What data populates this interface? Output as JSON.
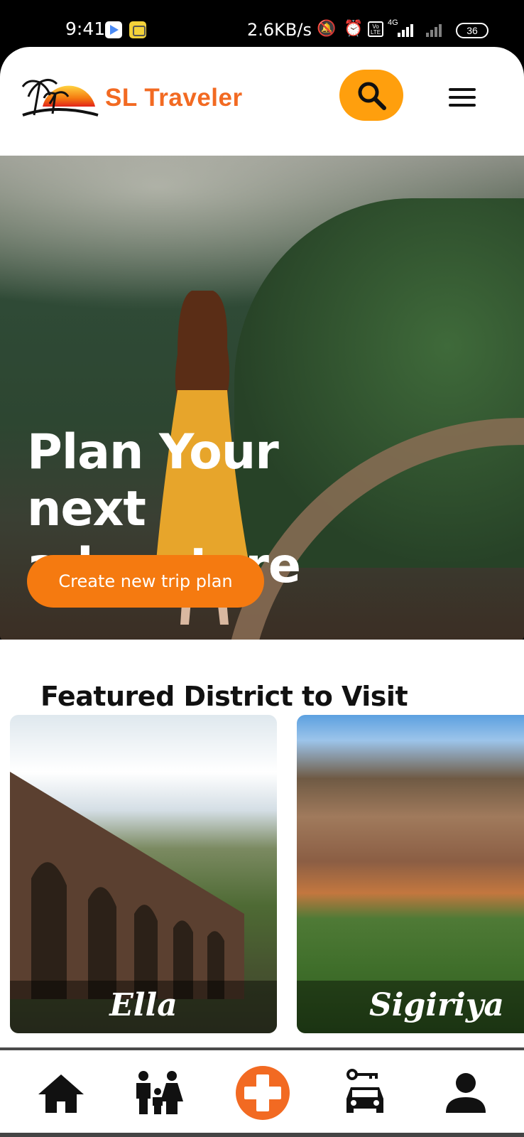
{
  "status_bar": {
    "time": "9:41",
    "speed": "2.6KB/s",
    "network": "4G",
    "volte": "Vo LTE",
    "battery": "36"
  },
  "header": {
    "brand": "SL Traveler",
    "icons": {
      "logo": "palm-sunset-logo",
      "search": "search-icon",
      "menu": "hamburger-menu-icon"
    },
    "accent_color": "#f26a22",
    "search_color": "#ff9f0d"
  },
  "hero": {
    "title": "Plan Your next adventure",
    "cta_label": "Create new trip plan"
  },
  "featured": {
    "title": "Featured District to Visit",
    "districts": [
      {
        "name": "Ella"
      },
      {
        "name": "Sigiriya"
      }
    ]
  },
  "bottom_nav": {
    "items": [
      {
        "icon": "home-icon"
      },
      {
        "icon": "family-icon"
      },
      {
        "icon": "add-icon"
      },
      {
        "icon": "car-rental-icon"
      },
      {
        "icon": "profile-icon"
      }
    ]
  }
}
